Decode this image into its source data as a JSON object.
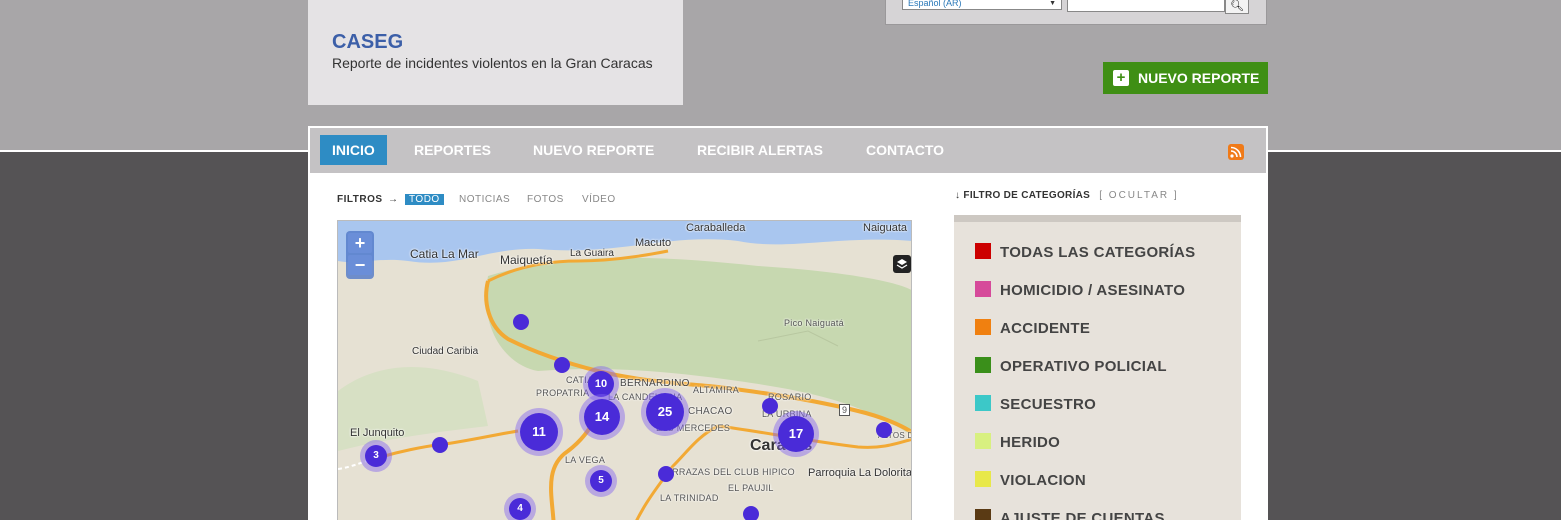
{
  "brand": {
    "title": "CASEG",
    "subtitle": "Reporte de incidentes violentos en la Gran Caracas"
  },
  "search": {
    "language": "Español (AR)",
    "button_icon": "search-icon"
  },
  "new_report_button": {
    "label": "NUEVO REPORTE",
    "icon": "plus-icon"
  },
  "nav": {
    "items": [
      "INICIO",
      "REPORTES",
      "NUEVO REPORTE",
      "RECIBIR ALERTAS",
      "CONTACTO"
    ],
    "active": "INICIO",
    "rss_icon": "rss-icon"
  },
  "filters": {
    "label": "FILTROS",
    "arrow": "→",
    "options": [
      "TODO",
      "NOTICIAS",
      "FOTOS",
      "VÍDEO"
    ],
    "active": "TODO"
  },
  "map": {
    "zoom_in": "+",
    "zoom_out": "−",
    "labels": [
      "Caraballeda",
      "Naiguata",
      "Macuto",
      "Catia La Mar",
      "Maiquetía",
      "La Guaira",
      "Pico Naiguatá",
      "Ciudad Caribia",
      "BERNARDINO",
      "LA CANDELARIA",
      "ALTAMIRA",
      "CHACAO",
      "ROSARIO",
      "LAS MERCEDES",
      "LA URBINA",
      "El Junquito",
      "Caracas",
      "Parroquia La Dolorita",
      "ALTOS DE PARQUE CAIZA",
      "LA VEGA",
      "TERRAZAS DEL CLUB HIPICO",
      "LA TRINIDAD",
      "EL PAUJIL",
      "PROPATRIA",
      "CATIA",
      "9"
    ],
    "clusters": [
      "10",
      "14",
      "25",
      "11",
      "17",
      "3",
      "5",
      "4"
    ]
  },
  "categories": {
    "header": "FILTRO DE CATEGORÍAS",
    "header_arrow": "↓",
    "hide_label": "[ OCULTAR ]",
    "items": [
      {
        "label": "TODAS LAS CATEGORÍAS",
        "color": "#cc0000"
      },
      {
        "label": "HOMICIDIO / ASESINATO",
        "color": "#d64a9a"
      },
      {
        "label": "ACCIDENTE",
        "color": "#f08010"
      },
      {
        "label": "OPERATIVO POLICIAL",
        "color": "#3a8f1a"
      },
      {
        "label": "SECUESTRO",
        "color": "#3cc8c8"
      },
      {
        "label": "HERIDO",
        "color": "#d8f080"
      },
      {
        "label": "VIOLACION",
        "color": "#e8e84a"
      },
      {
        "label": "AJUSTE DE CUENTAS",
        "color": "#5a3a14"
      }
    ]
  }
}
